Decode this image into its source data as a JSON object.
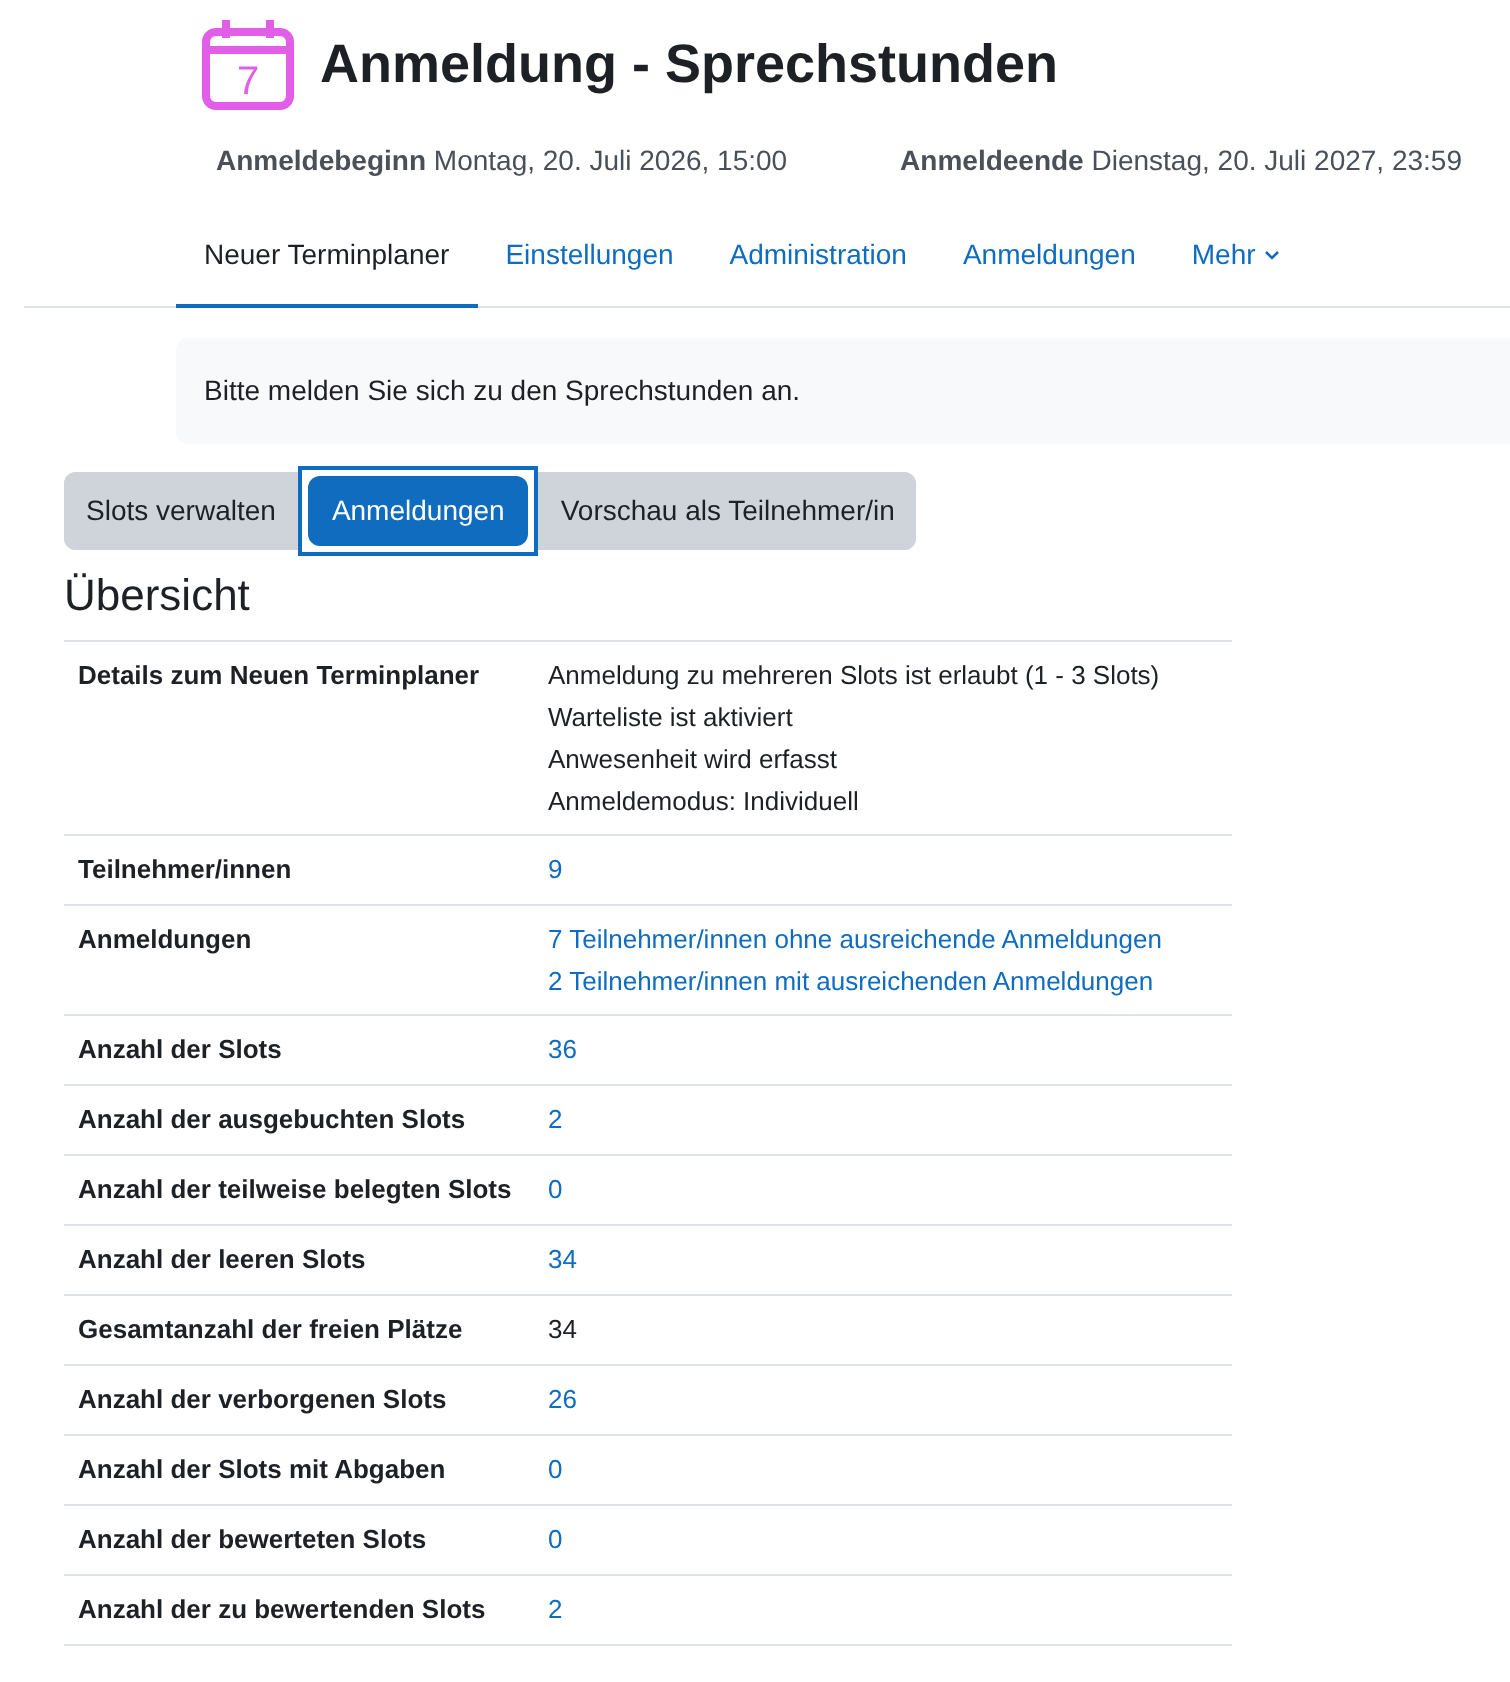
{
  "header": {
    "title": "Anmeldung - Sprechstunden",
    "icon_number": "7"
  },
  "dates": [
    {
      "label": "Anmeldebeginn",
      "value": "Montag, 20. Juli 2026, 15:00"
    },
    {
      "label": "Anmeldeende",
      "value": "Dienstag, 20. Juli 2027, 23:59"
    }
  ],
  "tabs": [
    {
      "label": "Neuer Terminplaner",
      "selected": true,
      "dropdown": false
    },
    {
      "label": "Einstellungen",
      "selected": false,
      "dropdown": false
    },
    {
      "label": "Administration",
      "selected": false,
      "dropdown": false
    },
    {
      "label": "Anmeldungen",
      "selected": false,
      "dropdown": false
    },
    {
      "label": "Mehr",
      "selected": false,
      "dropdown": true
    }
  ],
  "notice": "Bitte melden Sie sich zu den Sprechstunden an.",
  "view_buttons": [
    {
      "label": "Slots verwalten",
      "selected": false
    },
    {
      "label": "Anmeldungen",
      "selected": true
    },
    {
      "label": "Vorschau als Teilnehmer/in",
      "selected": false
    }
  ],
  "section_title": "Übersicht",
  "table": {
    "rows": [
      {
        "label": "Details zum Neuen Terminplaner",
        "values": [
          {
            "kind": "text",
            "text": "Anmeldung zu mehreren Slots ist erlaubt (1 - 3 Slots)"
          },
          {
            "kind": "text",
            "text": "Warteliste ist aktiviert"
          },
          {
            "kind": "text",
            "text": "Anwesenheit wird erfasst"
          },
          {
            "kind": "text",
            "text": "Anmeldemodus: Individuell"
          }
        ]
      },
      {
        "label": "Teilnehmer/innen",
        "values": [
          {
            "kind": "link",
            "text": "9"
          }
        ]
      },
      {
        "label": "Anmeldungen",
        "values": [
          {
            "kind": "link",
            "text": "7 Teilnehmer/innen ohne ausreichende Anmeldungen"
          },
          {
            "kind": "link",
            "text": "2 Teilnehmer/innen mit ausreichenden Anmeldungen"
          }
        ]
      },
      {
        "label": "Anzahl der Slots",
        "values": [
          {
            "kind": "link",
            "text": "36"
          }
        ]
      },
      {
        "label": "Anzahl der ausgebuchten Slots",
        "values": [
          {
            "kind": "link",
            "text": "2"
          }
        ]
      },
      {
        "label": "Anzahl der teilweise belegten Slots",
        "values": [
          {
            "kind": "link",
            "text": "0"
          }
        ]
      },
      {
        "label": "Anzahl der leeren Slots",
        "values": [
          {
            "kind": "link",
            "text": "34"
          }
        ]
      },
      {
        "label": "Gesamtanzahl der freien Plätze",
        "values": [
          {
            "kind": "text",
            "text": "34"
          }
        ]
      },
      {
        "label": "Anzahl der verborgenen Slots",
        "values": [
          {
            "kind": "link",
            "text": "26"
          }
        ]
      },
      {
        "label": "Anzahl der Slots mit Abgaben",
        "values": [
          {
            "kind": "link",
            "text": "0"
          }
        ]
      },
      {
        "label": "Anzahl der bewerteten Slots",
        "values": [
          {
            "kind": "link",
            "text": "0"
          }
        ]
      },
      {
        "label": "Anzahl der zu bewertenden Slots",
        "values": [
          {
            "kind": "link",
            "text": "2"
          }
        ]
      }
    ]
  }
}
